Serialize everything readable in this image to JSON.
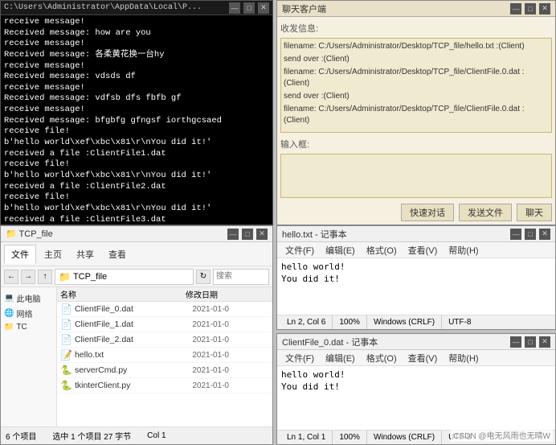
{
  "terminal": {
    "title": "C:\\Users\\Administrator\\AppData\\Local\\P...",
    "lines": [
      "receive message!",
      "Received message: how are you",
      "receive message!",
      "Received message: 各柔黄花换一台hy",
      "receive message!",
      "Received message: vdsds df",
      "receive message!",
      "Received message: vdfsb dfs fbfb gf",
      "receive message!",
      "Received message: bfgbfg gfngsf iorthgcsaed",
      "receive file!",
      "b'hello world\\xef\\xbc\\x81\\r\\nYou did it!'",
      "received a file :ClientFile1.dat",
      "receive file!",
      "b'hello world\\xef\\xbc\\x81\\r\\nYou did it!'",
      "received a file :ClientFile2.dat",
      "receive file!",
      "b'hello world\\xef\\xbc\\x81\\r\\nYou did it!'",
      "received a file :ClientFile3.dat"
    ]
  },
  "chat": {
    "title": "聊天客户端",
    "messages_label": "收发信息:",
    "messages": [
      "filename: C:/Users/Administrator/Desktop/TCP_file/hello.txt :(Client)",
      "send over :(Client)",
      "filename: C:/Users/Administrator/Desktop/TCP_file/ClientFile.0.dat :(Client)",
      "send over :(Client)",
      "filename: C:/Users/Administrator/Desktop/TCP_file/ClientFile.0.dat :(Client)"
    ],
    "input_label": "输入框:",
    "buttons": {
      "quick": "快速对话",
      "send_file": "发送文件",
      "chat": "聊天"
    }
  },
  "explorer": {
    "title": "TCP_file",
    "tabs": [
      "文件",
      "主页",
      "共享",
      "查看"
    ],
    "active_tab": "文件",
    "path": "TCP_file",
    "search_placeholder": "搜索",
    "sidebar_items": [
      "此电脑",
      "网络",
      "TC"
    ],
    "files": [
      {
        "name": "ClientFile_0.dat",
        "date": "2021-01-0",
        "type": "dat",
        "selected": false
      },
      {
        "name": "ClientFile_1.dat",
        "date": "2021-01-0",
        "type": "dat",
        "selected": false
      },
      {
        "name": "ClientFile_2.dat",
        "date": "2021-01-0",
        "type": "dat",
        "selected": false
      },
      {
        "name": "hello.txt",
        "date": "2021-01-0",
        "type": "txt",
        "selected": false
      },
      {
        "name": "serverCmd.py",
        "date": "2021-01-0",
        "type": "py",
        "selected": false
      },
      {
        "name": "tkinterClient.py",
        "date": "2021-01-0",
        "type": "py",
        "selected": false
      }
    ],
    "status_left": "6 个项目",
    "status_right": "选中 1 个项目 27 字节",
    "col1_label": "Col 1"
  },
  "notepad1": {
    "title": "hello.txt - 记事本",
    "menu_items": [
      "文件(F)",
      "编辑(E)",
      "格式(O)",
      "查看(V)",
      "帮助(H)"
    ],
    "content_lines": [
      "hello world!",
      "You did it!"
    ],
    "status": {
      "position": "Ln 2, Col 6",
      "zoom": "100%",
      "line_ending": "Windows (CRLF)",
      "encoding": "UTF-8"
    }
  },
  "notepad2": {
    "title": "ClientFile_0.dat - 记事本",
    "menu_items": [
      "文件(F)",
      "编辑(E)",
      "格式(O)",
      "查看(V)",
      "帮助(H)"
    ],
    "content_lines": [
      "hello world!",
      "You did it!"
    ],
    "status": {
      "position": "Ln 1, Col 1",
      "zoom": "100%",
      "line_ending": "Windows (CRLF)",
      "encoding": "UTF-8"
    }
  },
  "watermark": "CSDN @电无风雨也无晴W",
  "icons": {
    "minimize": "—",
    "maximize": "□",
    "close": "✕",
    "back": "←",
    "forward": "→",
    "up": "↑",
    "refresh": "↻",
    "folder": "📁",
    "file_dat": "📄",
    "file_txt": "📝",
    "file_py": "🐍",
    "computer": "💻",
    "network": "🌐"
  }
}
